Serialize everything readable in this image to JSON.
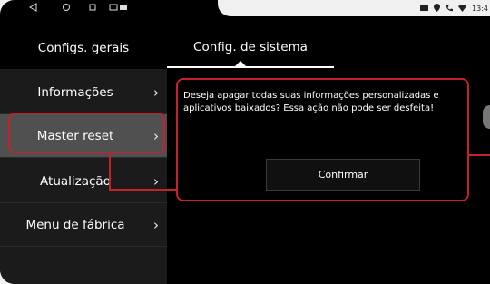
{
  "statusbar": {
    "left_icons": [
      "back-icon",
      "home-icon",
      "recents-icon",
      "cast-icon",
      "image-icon"
    ],
    "right_icons": [
      "sms-icon",
      "location-icon",
      "phone-icon",
      "wifi-icon"
    ],
    "time": "13:4"
  },
  "tabs": [
    {
      "label": "Configs. gerais"
    },
    {
      "label": "Config. de sistema",
      "active": true
    }
  ],
  "sidebar": {
    "items": [
      {
        "label": "Informações"
      },
      {
        "label": "Master reset",
        "active": true
      },
      {
        "label": "Atualização"
      },
      {
        "label": "Menu de fábrica"
      }
    ]
  },
  "dialog": {
    "message": "Deseja apagar todas suas informações personalizadas e aplicativos baixados? Essa ação não pode ser desfeita!",
    "confirm_label": "Confirmar"
  },
  "colors": {
    "highlight": "#c42128",
    "active_item": "#505050"
  }
}
